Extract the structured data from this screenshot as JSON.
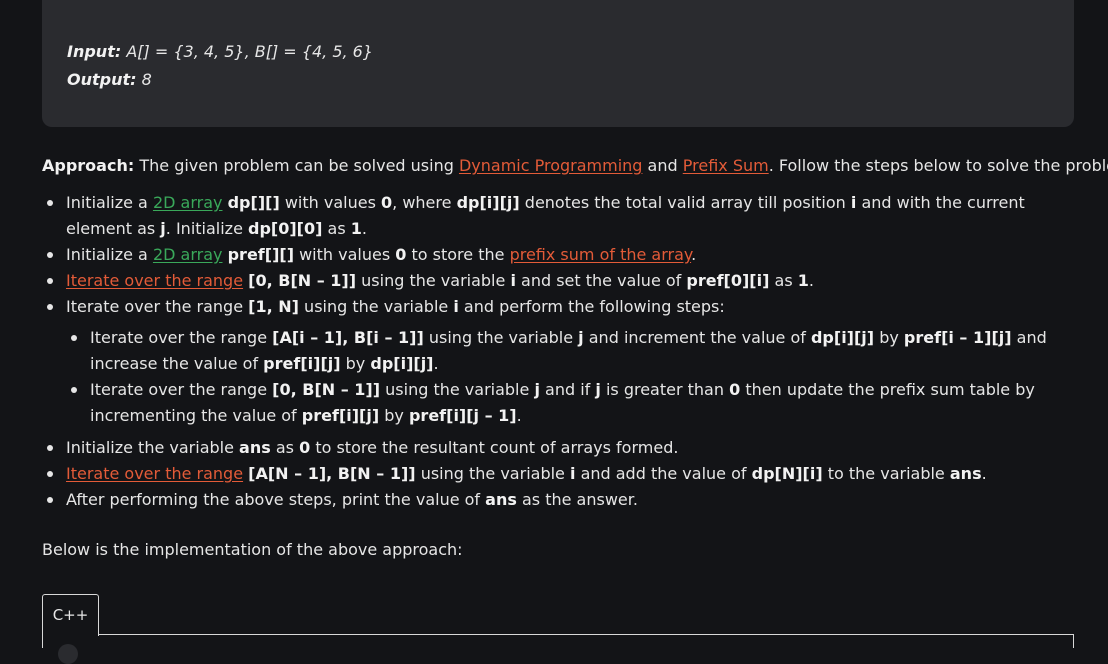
{
  "example": {
    "input_label": "Input:",
    "input_value": "A[] = {3, 4, 5}, B[] = {4, 5, 6}",
    "output_label": "Output:",
    "output_value": "8"
  },
  "approach": {
    "label": "Approach:",
    "text_1": "The given problem can be solved using",
    "link_dp": "Dynamic Programming",
    "text_2": "and",
    "link_prefix": "Prefix Sum",
    "text_3": ". Follow the steps below to solve the problem:"
  },
  "steps": {
    "s1": {
      "t1": "Initialize a",
      "link": "2D array",
      "c1": "dp[][]",
      "t2": "with values",
      "c2": "0",
      "t3": ", where",
      "c3": "dp[i][j]",
      "t4": "denotes the total valid array till position",
      "c4": "i",
      "t5": "and with the current element as",
      "c5": "j",
      "t6": ". Initialize",
      "c6": "dp[0][0]",
      "t7": "as",
      "c7": "1",
      "t8": "."
    },
    "s2": {
      "t1": "Initialize a",
      "link": "2D array",
      "c1": "pref[][]",
      "t2": "with values",
      "c2": "0",
      "t3": "to store the",
      "link2": "prefix sum of the array",
      "t4": "."
    },
    "s3": {
      "link": "Iterate over the range",
      "c1": "[0, B[N – 1]]",
      "t1": "using the variable",
      "c2": "i",
      "t2": "and set the value of",
      "c3": "pref[0][i]",
      "t3": "as",
      "c4": "1",
      "t4": "."
    },
    "s4": {
      "t1": "Iterate over the range",
      "c1": "[1, N]",
      "t2": "using the variable",
      "c2": "i",
      "t3": "and perform the following steps:",
      "sub1": {
        "t1": "Iterate over the range",
        "c1": "[A[i – 1], B[i – 1]]",
        "t2": "using the variable",
        "c2": "j",
        "t3": "and increment the value of",
        "c3": "dp[i][j]",
        "t4": "by",
        "c4": "pref[i – 1][j]",
        "t5": "and increase the value of",
        "c5": "pref[i][j]",
        "t6": "by",
        "c6": "dp[i][j]",
        "t7": "."
      },
      "sub2": {
        "t1": "Iterate over the range",
        "c1": "[0, B[N – 1]]",
        "t2": "using the variable",
        "c2": "j",
        "t3": "and if",
        "c3": "j",
        "t4": "is greater than",
        "c4": "0",
        "t5": "then update the prefix sum table by incrementing the value of",
        "c5": "pref[i][j]",
        "t6": "by",
        "c6": "pref[i][j – 1]",
        "t7": "."
      }
    },
    "s5": {
      "t1": "Initialize the variable",
      "c1": "ans",
      "t2": "as",
      "c2": "0",
      "t3": "to store the resultant count of arrays formed."
    },
    "s6": {
      "link": "Iterate over the range",
      "c1": "[A[N – 1], B[N – 1]]",
      "t1": "using the variable",
      "c2": "i",
      "t2": "and add the value of",
      "c3": "dp[N][i]",
      "t3": "to the variable",
      "c4": "ans",
      "t4": "."
    },
    "s7": {
      "t1": "After performing the above steps, print the value of",
      "c1": "ans",
      "t2": "as the answer."
    }
  },
  "below_text": "Below is the implementation of the above approach:",
  "code_tab": "C++"
}
